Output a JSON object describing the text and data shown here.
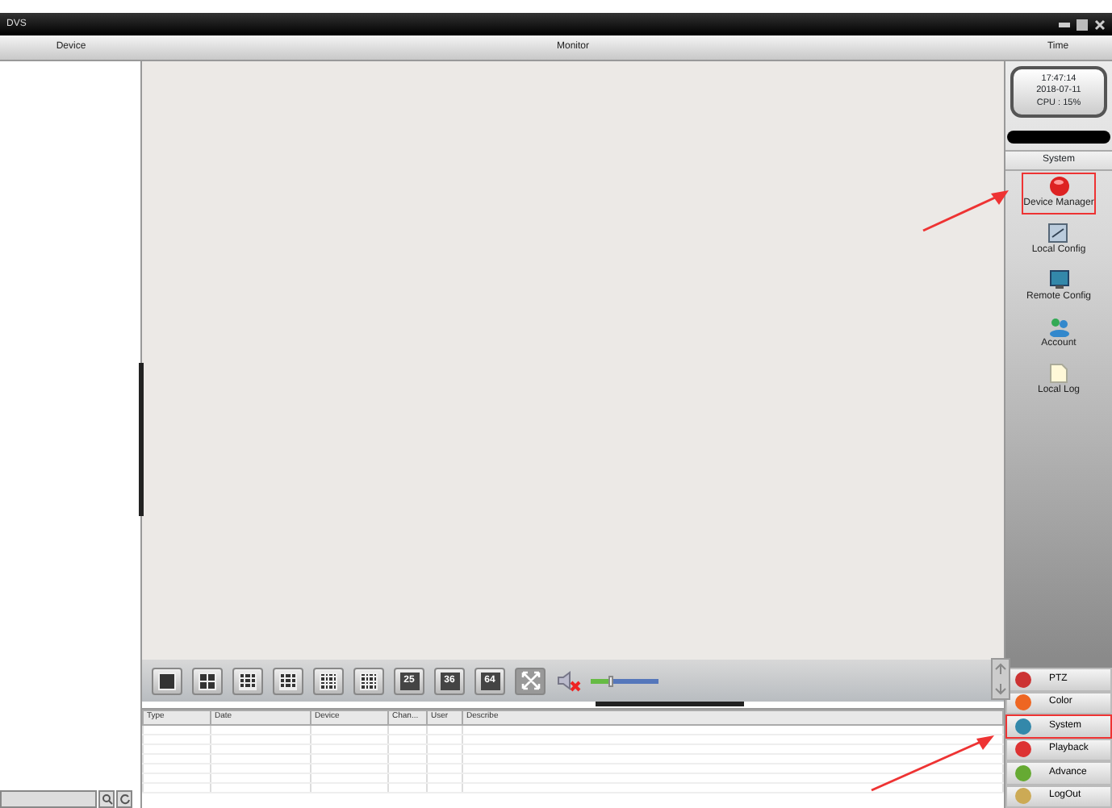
{
  "window": {
    "title": "DVS"
  },
  "header": {
    "left": "Device",
    "center": "Monitor",
    "right": "Time"
  },
  "clock": {
    "time": "17:47:14",
    "date": "2018-07-11",
    "cpu": "CPU : 15%"
  },
  "system_panel": {
    "title": "System",
    "items": [
      {
        "label": "Device Manager",
        "selected": true
      },
      {
        "label": "Local Config",
        "selected": false
      },
      {
        "label": "Remote Config",
        "selected": false
      },
      {
        "label": "Account",
        "selected": false
      },
      {
        "label": "Local Log",
        "selected": false
      }
    ]
  },
  "layout_toolbar": [
    {
      "kind": "grid"
    },
    {
      "kind": "grid"
    },
    {
      "kind": "grid"
    },
    {
      "kind": "grid"
    },
    {
      "kind": "grid"
    },
    {
      "kind": "grid"
    },
    {
      "kind": "label",
      "label": "25"
    },
    {
      "kind": "label",
      "label": "36"
    },
    {
      "kind": "label",
      "label": "64"
    },
    {
      "kind": "fullscreen"
    }
  ],
  "volume": {
    "muted": true,
    "level": 0.3
  },
  "log_table": {
    "columns": [
      "Type",
      "Date",
      "Device",
      "Chan...",
      "User",
      "Describe"
    ]
  },
  "nav": [
    {
      "label": "PTZ",
      "selected": false
    },
    {
      "label": "Color",
      "selected": false
    },
    {
      "label": "System",
      "selected": true
    },
    {
      "label": "Playback",
      "selected": false
    },
    {
      "label": "Advance",
      "selected": false
    },
    {
      "label": "LogOut",
      "selected": false
    }
  ]
}
